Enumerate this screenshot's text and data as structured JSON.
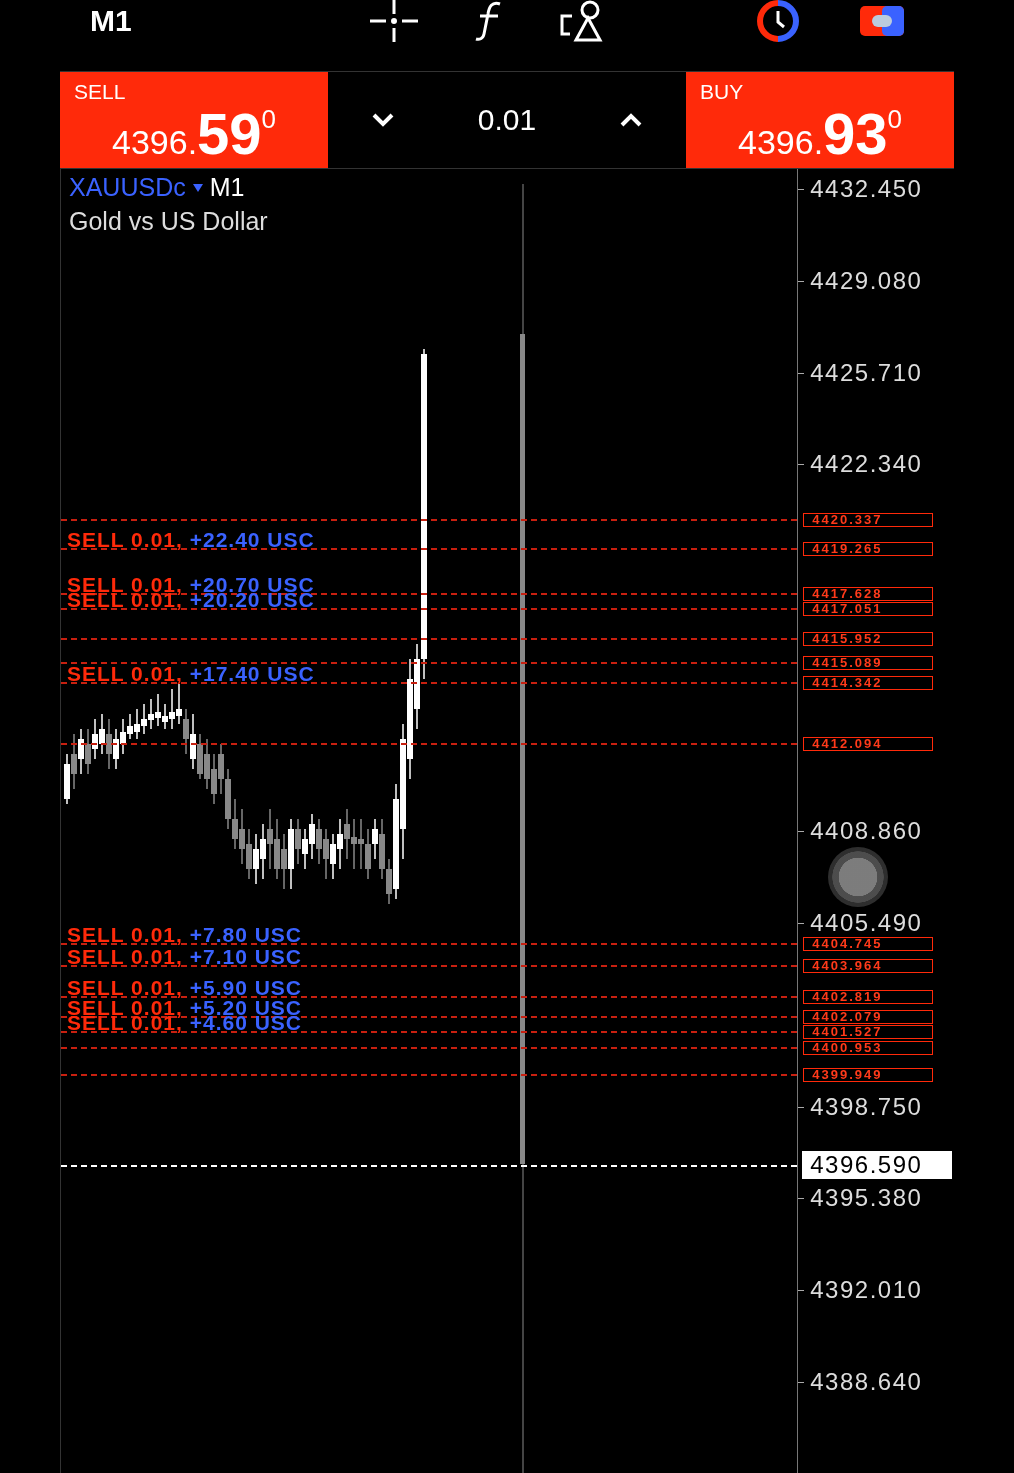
{
  "top_bar": {
    "timeframe": "M1"
  },
  "trade_panel": {
    "sell": {
      "label": "SELL",
      "price_small": "4396.",
      "price_big": "59",
      "price_sup": "0"
    },
    "volume": "0.01",
    "buy": {
      "label": "BUY",
      "price_small": "4396.",
      "price_big": "93",
      "price_sup": "0"
    }
  },
  "chart": {
    "symbol": "XAUUSDc",
    "timeframe": "M1",
    "description": "Gold vs US Dollar",
    "price_axis": [
      "4432.450",
      "4429.080",
      "4425.710",
      "4422.340",
      "4408.860",
      "4405.490",
      "4398.750",
      "4395.380",
      "4392.010",
      "4388.640"
    ],
    "orders": [
      {
        "price": "4420.337"
      },
      {
        "price": "4419.265",
        "side": "SELL 0.01,",
        "profit": "+22.40 USC"
      },
      {
        "price": "4417.628",
        "side": "SELL 0.01,",
        "profit": "+20.70 USC"
      },
      {
        "price": "4417.051",
        "side": "SELL 0.01,",
        "profit": "+20.20 USC"
      },
      {
        "price": "4415.952"
      },
      {
        "price": "4415.089"
      },
      {
        "price": "4414.342",
        "side": "SELL 0.01,",
        "profit": "+17.40 USC"
      },
      {
        "price": "4412.094"
      },
      {
        "price": "4404.745",
        "side": "SELL 0.01,",
        "profit": "+7.80 USC"
      },
      {
        "price": "4403.964",
        "side": "SELL 0.01,",
        "profit": "+7.10 USC"
      },
      {
        "price": "4402.819",
        "side": "SELL 0.01,",
        "profit": "+5.90 USC"
      },
      {
        "price": "4402.079",
        "side": "SELL 0.01,",
        "profit": "+5.20 USC"
      },
      {
        "price": "4401.527",
        "side": "SELL 0.01,",
        "profit": "+4.60 USC"
      },
      {
        "price": "4400.953"
      },
      {
        "price": "4399.949"
      }
    ],
    "current_price": "4396.590"
  }
}
